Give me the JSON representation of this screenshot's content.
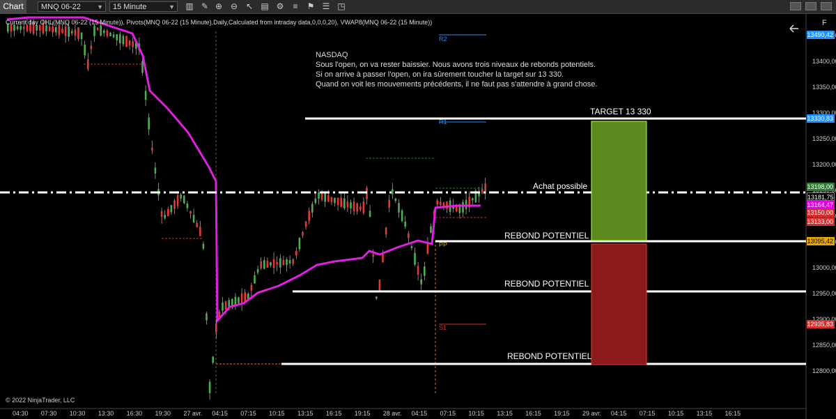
{
  "toolbar": {
    "tab_label": "Chart",
    "instrument": "MNQ 06-22",
    "interval": "15 Minute",
    "icons": [
      "bars-icon",
      "draw-icon",
      "zoom-in-icon",
      "zoom-out-icon",
      "properties-icon",
      "data-box-icon",
      "strategy-icon",
      "indicator-icon",
      "template-icon",
      "window-icon"
    ]
  },
  "indicator_label": "Current day OHL(MNQ 06-22 (15 Minute)), Pivots(MNQ 06-22 (15 Minute),Daily,Calculated from intraday data,0,0,0,20), VWAP8(MNQ 06-22 (15 Minute))",
  "copyright": "© 2022 NinjaTrader, LLC",
  "axis_top_label": "F",
  "annotation": {
    "title": "NASDAQ",
    "lines": [
      "Sous l'open, on va rester baissier. Nous avons trois niveaux de rebonds potentiels.",
      "Si on arrive à passer l'open, on ira sûrement toucher la target sur 13 330.",
      "Quand on voit les mouvements précédents, il ne faut pas s'attendre à grand chose."
    ]
  },
  "labels": {
    "target": "TARGET 13 330",
    "achat": "Achat possible",
    "rebond1": "REBOND POTENTIEL",
    "rebond2": "REBOND POTENTIEL",
    "rebond3": "REBOND POTENTIEL",
    "r2": "R2",
    "r1": "R1",
    "pp": "PP",
    "s1": "S1"
  },
  "y_axis": [
    "13450,00",
    "13400,00",
    "13350,00",
    "13300,00",
    "13250,00",
    "13200,00",
    "13150,00",
    "13100,00",
    "13050,00",
    "13000,00",
    "12950,00",
    "12900,00",
    "12850,00",
    "12800,00"
  ],
  "x_axis": [
    "04:30",
    "07:30",
    "10:30",
    "13:30",
    "16:30",
    "19:30",
    "27 avr.",
    "04:15",
    "07:15",
    "10:15",
    "13:15",
    "16:15",
    "19:15",
    "28 avr.",
    "04:15",
    "07:15",
    "10:15",
    "13:15",
    "16:15",
    "19:15",
    "29 avr.",
    "04:15",
    "07:15",
    "10:15",
    "13:15",
    "16:15"
  ],
  "price_tags": [
    {
      "value": "13490,42",
      "color": "#1e90ff"
    },
    {
      "value": "13330,83",
      "color": "#1e90ff"
    },
    {
      "value": "13198,00",
      "color": "#2e7d32"
    },
    {
      "value": "13181,75",
      "color": "#000000"
    },
    {
      "value": "13164,47",
      "color": "#e000e0"
    },
    {
      "value": "13150,00",
      "color": "#d32f2f"
    },
    {
      "value": "13133,00",
      "color": "#d32f2f"
    },
    {
      "value": "13095,42",
      "color": "#e6a800"
    },
    {
      "value": "12935,83",
      "color": "#d32f2f"
    }
  ],
  "colors": {
    "up_candle": "#4caf50",
    "down_candle": "#e53935",
    "vwap": "#e020e0",
    "target_box": "#5c8a1e",
    "stop_box": "#8b1a1a"
  }
}
